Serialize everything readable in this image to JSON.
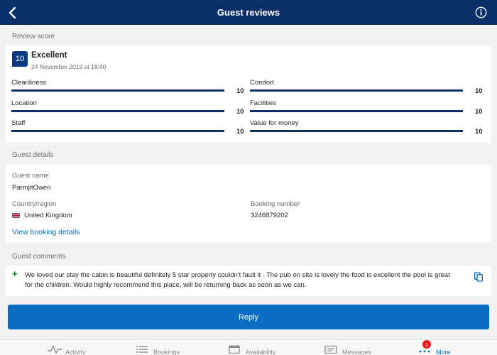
{
  "header": {
    "title": "Guest reviews"
  },
  "review_score": {
    "section_label": "Review score",
    "score": "10",
    "rating_word": "Excellent",
    "date": "24 November 2019 at 18:40",
    "categories": [
      {
        "name": "Cleanliness",
        "value": "10",
        "fraction": 1.0
      },
      {
        "name": "Comfort",
        "value": "10",
        "fraction": 1.0
      },
      {
        "name": "Location",
        "value": "10",
        "fraction": 1.0
      },
      {
        "name": "Facilities",
        "value": "10",
        "fraction": 1.0
      },
      {
        "name": "Staff",
        "value": "10",
        "fraction": 1.0
      },
      {
        "name": "Value for money",
        "value": "10",
        "fraction": 1.0
      }
    ]
  },
  "guest_details": {
    "section_label": "Guest details",
    "name_label": "Guest name",
    "name": "ParmjitOwen",
    "country_label": "Country/region",
    "country": "United Kingdom",
    "booking_label": "Booking number",
    "booking_number": "3246879202",
    "view_link": "View booking details"
  },
  "guest_comments": {
    "section_label": "Guest comments",
    "text": "We loved our stay the cabin is beautiful definitely 5 star property couldn't fault it . The pub on site is lovely the food is excellent the pool is great for the children. Would highly recommend this place, will be returning back as soon as we can."
  },
  "reply_label": "Reply",
  "tabs": [
    {
      "label": "Activity",
      "icon": "activity-icon"
    },
    {
      "label": "Bookings",
      "icon": "bookings-icon"
    },
    {
      "label": "Availability",
      "icon": "calendar-icon"
    },
    {
      "label": "Messages",
      "icon": "messages-icon"
    },
    {
      "label": "More",
      "icon": "more-icon",
      "badge": "1"
    }
  ],
  "colors": {
    "header_bg": "#0c2f6a",
    "score_badge": "#0c3a82",
    "bar_fill": "#0c2f6a",
    "link": "#0071c2",
    "reply_button": "#0a6cc2",
    "positive": "#008009",
    "notification": "#e21c1c"
  }
}
